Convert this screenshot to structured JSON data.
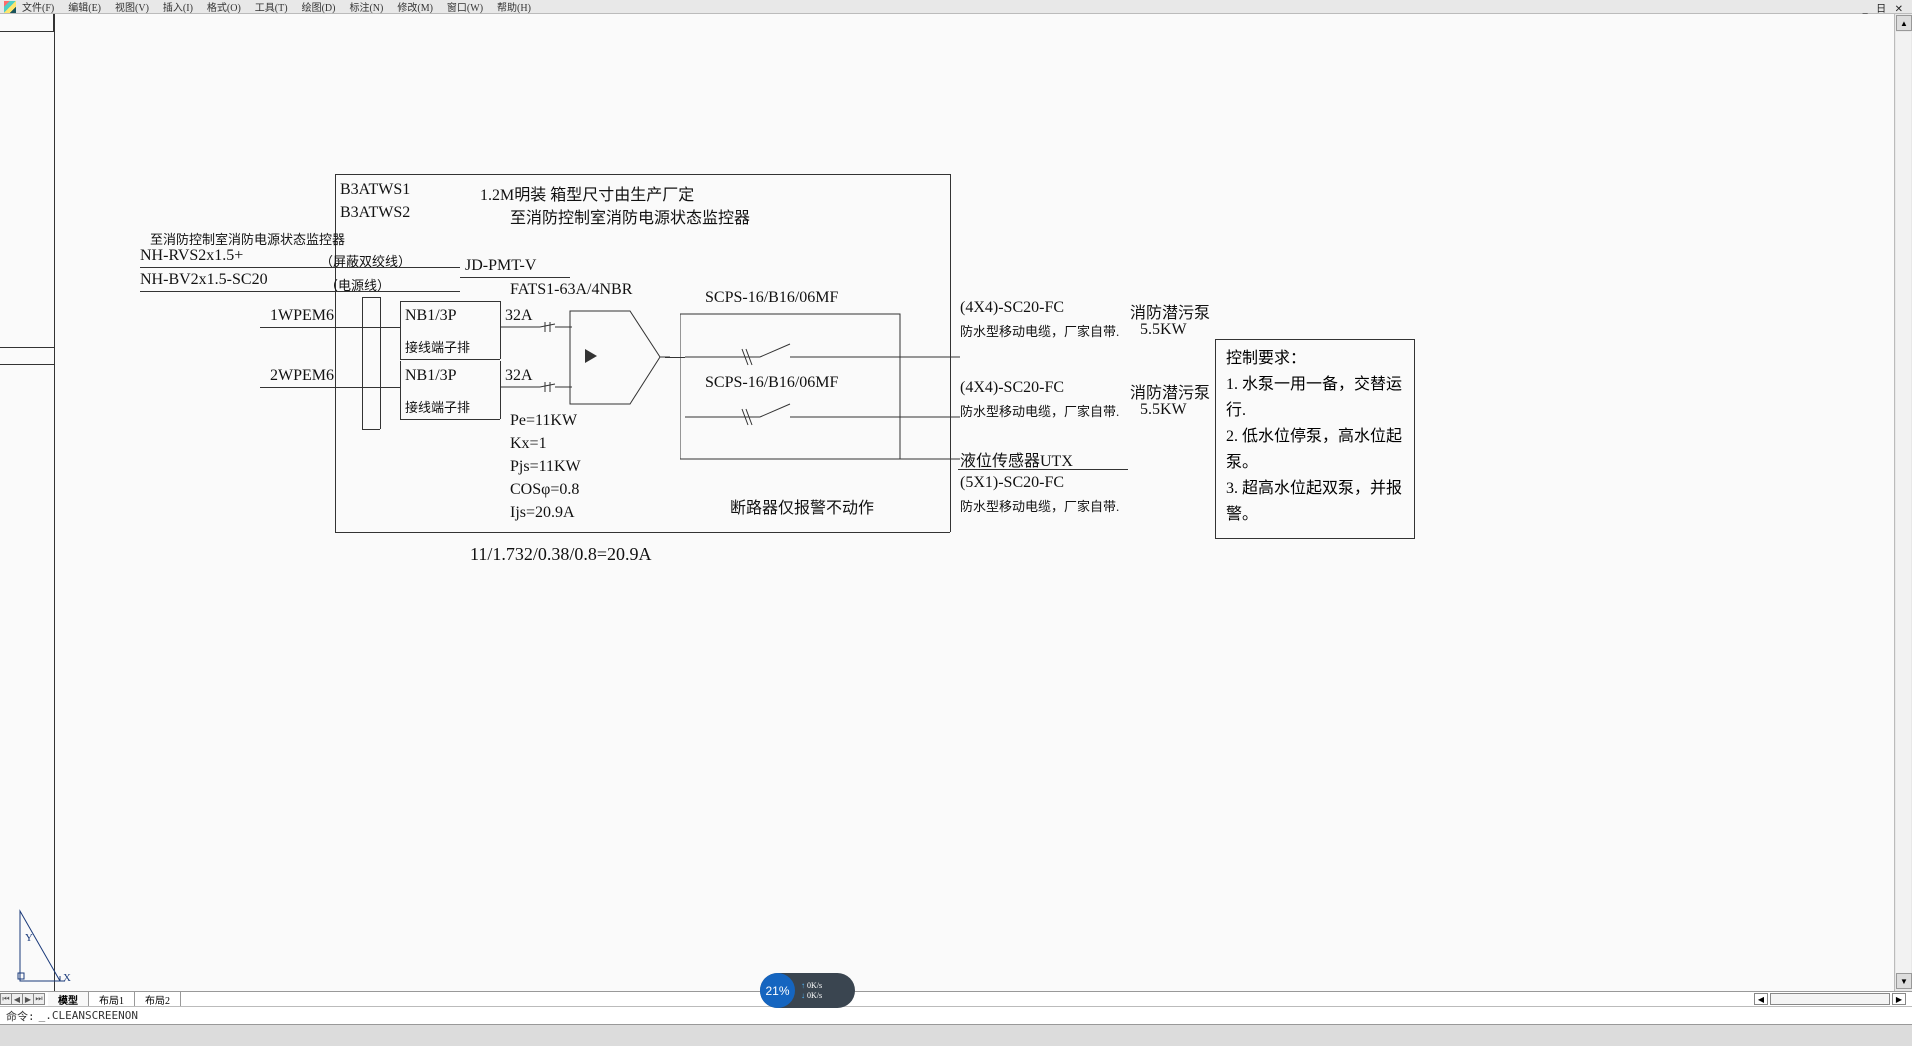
{
  "menu": {
    "items": [
      "文件(F)",
      "编辑(E)",
      "视图(V)",
      "插入(I)",
      "格式(O)",
      "工具(T)",
      "绘图(D)",
      "标注(N)",
      "修改(M)",
      "窗口(W)",
      "帮助(H)"
    ]
  },
  "windowControls": "_ 日 ✕",
  "tabs": {
    "model": "模型",
    "layout1": "布局1",
    "layout2": "布局2"
  },
  "cmd": {
    "label": "命令:",
    "text": "_.CLEANSCREENON"
  },
  "speed": {
    "pct": "21%",
    "up": "0K/s",
    "down": "0K/s"
  },
  "diagram": {
    "b3a1": "B3ATWS1",
    "b3a2": "B3ATWS2",
    "title1": "1.2M明装  箱型尺寸由生产厂定",
    "title2": "至消防控制室消防电源状态监控器",
    "leftnote": "至消防控制室消防电源状态监控器",
    "rvs": "NH-RVS2x1.5+",
    "rvsNote": "（屏蔽双绞线）",
    "bv": "NH-BV2x1.5-SC20",
    "bvNote": "（电源线）",
    "jdpmt": "JD-PMT-V",
    "fats": "FATS1-63A/4NBR",
    "wpe1": "1WPEM6",
    "wpe2": "2WPEM6",
    "nb1": "NB1/3P",
    "amps": "32A",
    "jxd": "接线端子排",
    "scps1": "SCPS-16/B16/06MF",
    "scps2": "SCPS-16/B16/06MF",
    "out1": "(4X4)-SC20-FC",
    "out2": "(4X4)-SC20-FC",
    "out3": "(5X1)-SC20-FC",
    "pump": "消防潜污泵",
    "kw": "5.5KW",
    "cable": "防水型移动电缆，厂家自带.",
    "sensor": "液位传感器UTX",
    "breaker": "断路器仅报警不动作",
    "pe": "Pe=11KW",
    "kx": "Kx=1",
    "pjs": "Pjs=11KW",
    "cos": "COSφ=0.8",
    "ijs": "Ijs=20.9A",
    "calc": "11/1.732/0.38/0.8=20.9A"
  },
  "notes": {
    "t": "控制要求：",
    "l1": "1. 水泵一用一备，交替运行.",
    "l2": "2. 低水位停泵，高水位起泵。",
    "l3": "3. 超高水位起双泵，并报警。"
  }
}
